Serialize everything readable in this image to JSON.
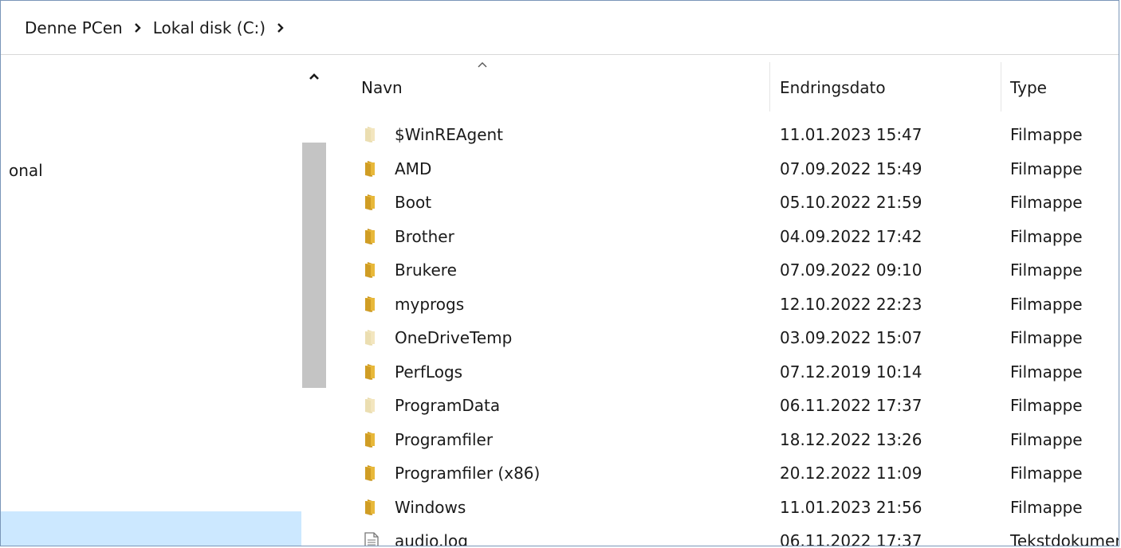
{
  "address": {
    "crumbs": [
      "Denne PCen",
      "Lokal disk (C:)"
    ]
  },
  "nav": {
    "visible_item": "onal"
  },
  "columns": {
    "name": "Navn",
    "date": "Endringsdato",
    "type": "Type"
  },
  "files": [
    {
      "name": "$WinREAgent",
      "date": "11.01.2023 15:47",
      "type": "Filmappe",
      "icon": "hidden-folder-icon"
    },
    {
      "name": "AMD",
      "date": "07.09.2022 15:49",
      "type": "Filmappe",
      "icon": "folder-icon"
    },
    {
      "name": "Boot",
      "date": "05.10.2022 21:59",
      "type": "Filmappe",
      "icon": "folder-icon"
    },
    {
      "name": "Brother",
      "date": "04.09.2022 17:42",
      "type": "Filmappe",
      "icon": "folder-icon"
    },
    {
      "name": "Brukere",
      "date": "07.09.2022 09:10",
      "type": "Filmappe",
      "icon": "folder-icon"
    },
    {
      "name": "myprogs",
      "date": "12.10.2022 22:23",
      "type": "Filmappe",
      "icon": "folder-icon"
    },
    {
      "name": "OneDriveTemp",
      "date": "03.09.2022 15:07",
      "type": "Filmappe",
      "icon": "hidden-folder-icon"
    },
    {
      "name": "PerfLogs",
      "date": "07.12.2019 10:14",
      "type": "Filmappe",
      "icon": "folder-icon"
    },
    {
      "name": "ProgramData",
      "date": "06.11.2022 17:37",
      "type": "Filmappe",
      "icon": "hidden-folder-icon"
    },
    {
      "name": "Programfiler",
      "date": "18.12.2022 13:26",
      "type": "Filmappe",
      "icon": "folder-icon"
    },
    {
      "name": "Programfiler (x86)",
      "date": "20.12.2022 11:09",
      "type": "Filmappe",
      "icon": "folder-icon"
    },
    {
      "name": "Windows",
      "date": "11.01.2023 21:56",
      "type": "Filmappe",
      "icon": "folder-icon"
    },
    {
      "name": "audio.log",
      "date": "06.11.2022 17:37",
      "type": "Tekstdokument",
      "icon": "text-file-icon"
    }
  ],
  "colors": {
    "folder": "#e8b83a",
    "folder_hidden": "#f3e6bf",
    "selection": "#cce8ff",
    "scroll_thumb": "#c4c4c4"
  }
}
